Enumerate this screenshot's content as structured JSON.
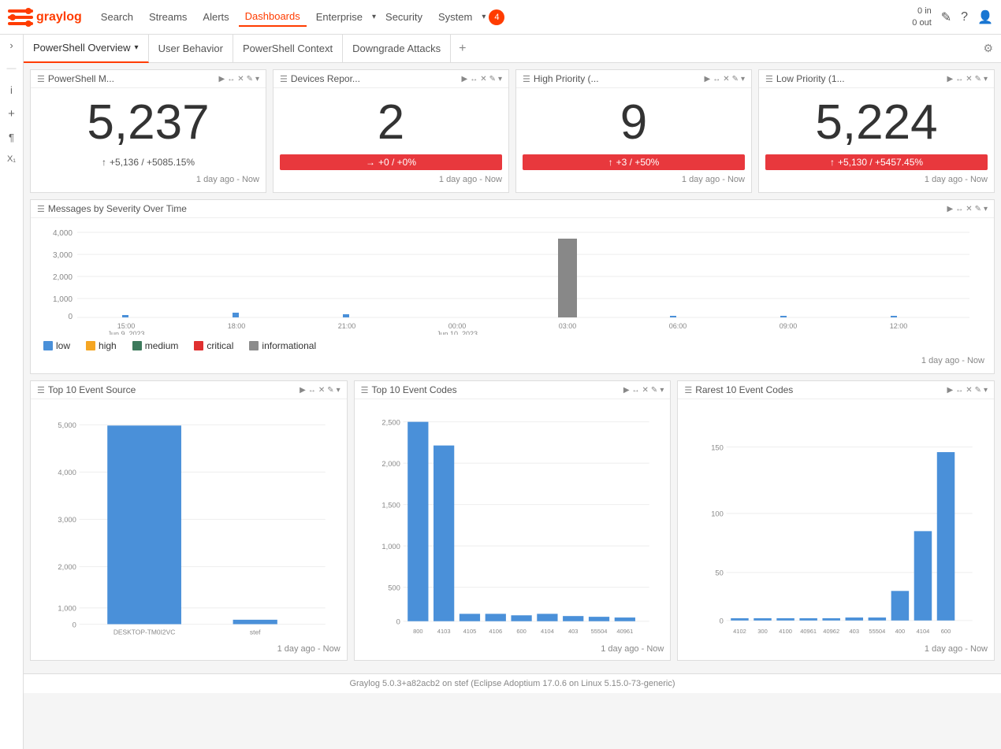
{
  "app": {
    "name": "Graylog",
    "version_footer": "Graylog 5.0.3+a82acb2 on stef (Eclipse Adoptium 17.0.6 on Linux 5.15.0-73-generic)"
  },
  "nav": {
    "links": [
      "Search",
      "Streams",
      "Alerts",
      "Dashboards",
      "Enterprise",
      "Security",
      "System"
    ],
    "active": "Dashboards",
    "notification_count": "4",
    "count_in": "0 in",
    "count_out": "0 out"
  },
  "tabs": {
    "items": [
      {
        "label": "PowerShell Overview",
        "active": true,
        "has_arrow": true
      },
      {
        "label": "User Behavior",
        "active": false
      },
      {
        "label": "PowerShell Context",
        "active": false
      },
      {
        "label": "Downgrade Attacks",
        "active": false
      }
    ]
  },
  "widgets": {
    "row1": [
      {
        "title": "PowerShell M...",
        "big_number": "5,237",
        "trend": "+5,136 / +5085.15%",
        "trend_type": "gray",
        "trend_icon": "↑",
        "time_range": "1 day ago - Now"
      },
      {
        "title": "Devices Repor...",
        "big_number": "2",
        "trend": "+0 / +0%",
        "trend_type": "red",
        "trend_icon": "→",
        "time_range": "1 day ago - Now"
      },
      {
        "title": "High Priority (...",
        "big_number": "9",
        "trend": "+3 / +50%",
        "trend_type": "red",
        "trend_icon": "↑",
        "time_range": "1 day ago - Now"
      },
      {
        "title": "Low Priority (1...",
        "big_number": "5,224",
        "trend": "+5,130 / +5457.45%",
        "trend_type": "red",
        "trend_icon": "↑",
        "time_range": "1 day ago - Now"
      }
    ],
    "severity_chart": {
      "title": "Messages by Severity Over Time",
      "time_range": "1 day ago - Now",
      "x_labels": [
        "15:00",
        "18:00",
        "21:00",
        "00:00",
        "03:00",
        "06:00",
        "09:00",
        "12:00"
      ],
      "x_sublabels": [
        "Jun 9, 2023",
        "",
        "",
        "Jun 10, 2023",
        "",
        "",
        "",
        ""
      ],
      "y_labels": [
        "4,000",
        "3,000",
        "2,000",
        "1,000",
        "0"
      ],
      "legend": [
        {
          "label": "low",
          "color": "#4a90d9"
        },
        {
          "label": "high",
          "color": "#f5a623"
        },
        {
          "label": "medium",
          "color": "#3d7a5c"
        },
        {
          "label": "critical",
          "color": "#e03030"
        },
        {
          "label": "informational",
          "color": "#8c8c8c"
        }
      ]
    },
    "bottom_row": [
      {
        "title": "Top 10 Event Source",
        "time_range": "1 day ago - Now",
        "bars": [
          {
            "label": "DESKTOP-TM0I2VC",
            "value": 5200,
            "max": 5500
          },
          {
            "label": "stef",
            "value": 30,
            "max": 5500
          }
        ],
        "y_labels": [
          "5,000",
          "4,000",
          "3,000",
          "2,000",
          "1,000",
          "0"
        ]
      },
      {
        "title": "Top 10 Event Codes",
        "time_range": "1 day ago - Now",
        "bars": [
          {
            "label": "800",
            "value": 2700,
            "max": 2800
          },
          {
            "label": "4103",
            "value": 2300,
            "max": 2800
          },
          {
            "label": "4105",
            "value": 100,
            "max": 2800
          },
          {
            "label": "4106",
            "value": 100,
            "max": 2800
          },
          {
            "label": "600",
            "value": 80,
            "max": 2800
          },
          {
            "label": "4104",
            "value": 100,
            "max": 2800
          },
          {
            "label": "403",
            "value": 60,
            "max": 2800
          },
          {
            "label": "55504",
            "value": 50,
            "max": 2800
          },
          {
            "label": "40961",
            "value": 40,
            "max": 2800
          }
        ],
        "y_labels": [
          "2,500",
          "2,000",
          "1,500",
          "1,000",
          "500",
          "0"
        ]
      },
      {
        "title": "Rarest 10 Event Codes",
        "time_range": "1 day ago - Now",
        "bars": [
          {
            "label": "4102",
            "value": 2,
            "max": 175
          },
          {
            "label": "300",
            "value": 2,
            "max": 175
          },
          {
            "label": "4100",
            "value": 2,
            "max": 175
          },
          {
            "label": "40961",
            "value": 2,
            "max": 175
          },
          {
            "label": "40962",
            "value": 2,
            "max": 175
          },
          {
            "label": "403",
            "value": 3,
            "max": 175
          },
          {
            "label": "55504",
            "value": 3,
            "max": 175
          },
          {
            "label": "400",
            "value": 30,
            "max": 175
          },
          {
            "label": "4104",
            "value": 90,
            "max": 175
          },
          {
            "label": "600",
            "value": 170,
            "max": 175
          }
        ],
        "y_labels": [
          "150",
          "100",
          "50",
          "0"
        ]
      }
    ]
  },
  "sidebar": {
    "icons": [
      "›",
      "—",
      "i",
      "+",
      "¶",
      "X₁"
    ]
  }
}
